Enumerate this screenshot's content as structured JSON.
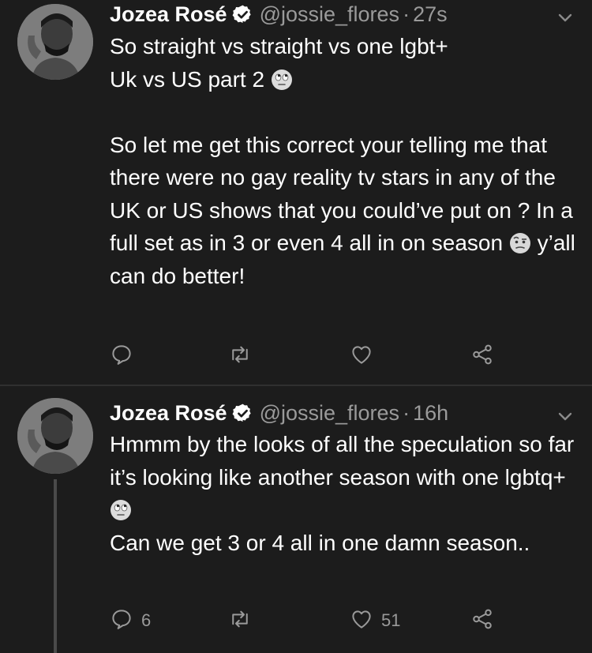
{
  "tweets": [
    {
      "name": "Jozea Rosé",
      "handle": "@jossie_flores",
      "separator": "·",
      "time": "27s",
      "text_part1": "So straight vs straight vs one lgbt+\nUk vs US part 2 ",
      "emoji1": "face-with-rolling-eyes",
      "text_part2": "\n\nSo let me get this correct your telling me that there were no gay reality tv stars in any of the UK or US shows that you could’ve put on ? In a full set as in 3 or even 4 all in on season ",
      "emoji2": "face-with-raised-eyebrow",
      "text_part3": " y’all can do better!",
      "reply_count": "",
      "like_count": ""
    },
    {
      "name": "Jozea Rosé",
      "handle": "@jossie_flores",
      "separator": "·",
      "time": "16h",
      "text_part1": "Hmmm by the looks of all the speculation so far it’s looking like another season with one lgbtq+",
      "emoji1": "face-with-rolling-eyes",
      "text_part2": "\nCan we get 3 or 4 all in one damn season..",
      "reply_count": "6",
      "like_count": "51"
    }
  ],
  "icons": {
    "verified": "verified-badge-icon",
    "more": "chevron-down-icon",
    "reply": "reply-icon",
    "retweet": "retweet-icon",
    "like": "heart-icon",
    "share": "share-icon"
  },
  "colors": {
    "background": "#1c1c1c",
    "text": "#ffffff",
    "secondary": "#9a9a9a",
    "divider": "#303030"
  }
}
